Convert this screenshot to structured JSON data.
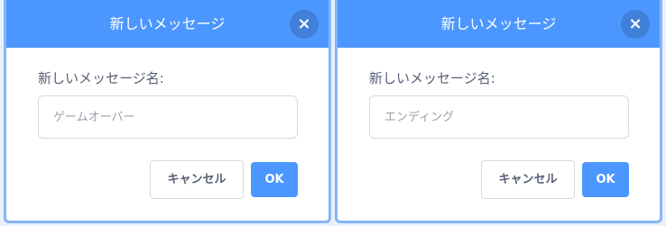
{
  "dialogs": [
    {
      "title": "新しいメッセージ",
      "close_icon": "×",
      "field_label": "新しいメッセージ名:",
      "input_value": "",
      "input_placeholder": "ゲームオーバー",
      "cancel_label": "キャンセル",
      "ok_label": "OK"
    },
    {
      "title": "新しいメッセージ",
      "close_icon": "×",
      "field_label": "新しいメッセージ名:",
      "input_value": "",
      "input_placeholder": "エンディング",
      "cancel_label": "キャンセル",
      "ok_label": "OK"
    }
  ],
  "icons": {
    "close": "close-icon"
  },
  "colors": {
    "header": "#4c97ff",
    "border": "#87b5f9",
    "text": "#575e75",
    "ok_button": "#4c97ff"
  }
}
